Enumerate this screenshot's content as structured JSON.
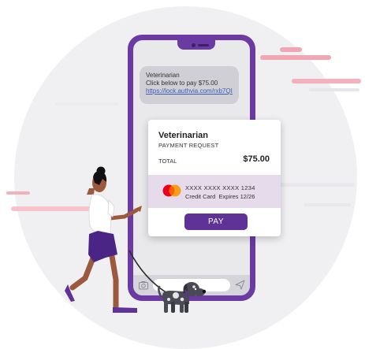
{
  "message": {
    "sender": "Veterinarian",
    "body": "Click below to pay $75.00",
    "link": "https://lock.authvia.com/rxb7QI"
  },
  "payment": {
    "merchant": "Veterinarian",
    "subtitle": "PAYMENT REQUEST",
    "total_label": "TOTAL",
    "total_amount": "$75.00",
    "card_number": "XXXX XXXX XXXX 1234",
    "card_type": "Credit Card",
    "expires": "Expires 12/26",
    "pay_label": "PAY"
  },
  "icons": {
    "card_brand": "mastercard-icon",
    "camera": "camera-icon",
    "send": "send-icon"
  },
  "colors": {
    "brand_purple": "#6b3aa2",
    "pay_button": "#5e3296",
    "accent_pink": "#f1a6b3"
  }
}
